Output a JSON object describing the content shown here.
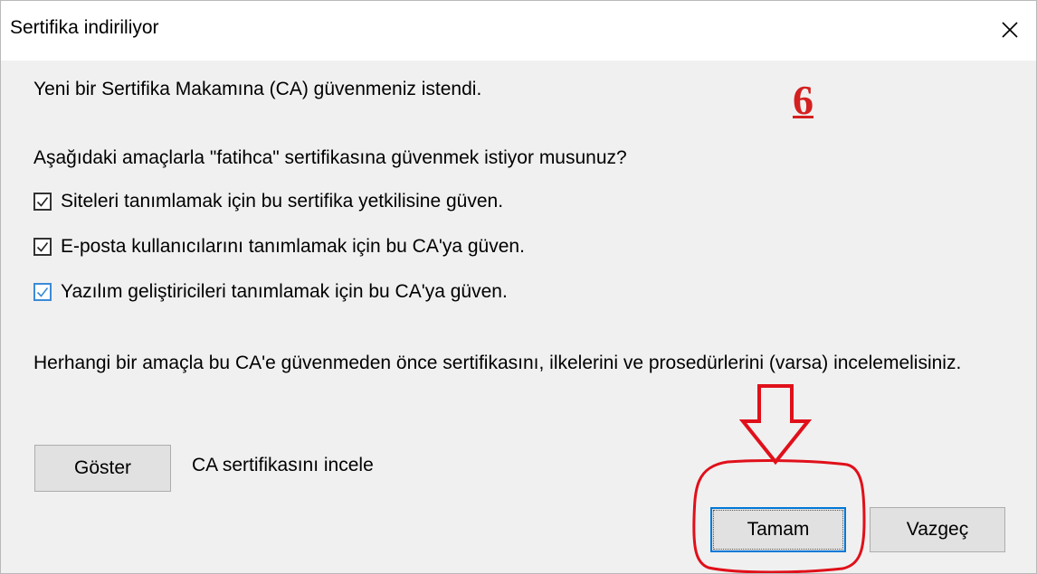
{
  "dialog": {
    "title": "Sertifika indiriliyor",
    "intro": "Yeni bir Sertifika Makamına (CA) güvenmeniz istendi.",
    "question": "Aşağıdaki amaçlarla \"fatihca\" sertifikasına güvenmek istiyor musunuz?",
    "options": [
      {
        "label": "Siteleri tanımlamak için bu sertifika yetkilisine güven.",
        "checked": true
      },
      {
        "label": "E-posta kullanıcılarını tanımlamak için bu CA'ya güven.",
        "checked": true
      },
      {
        "label": "Yazılım geliştiricileri tanımlamak için bu CA'ya güven.",
        "checked": true
      }
    ],
    "notice": "Herhangi bir amaçla bu CA'e güvenmeden önce sertifikasını, ilkelerini ve prosedürlerini (varsa) incelemelisiniz.",
    "show_button": "Göster",
    "show_description": "CA sertifikasını incele",
    "ok_button": "Tamam",
    "cancel_button": "Vazgeç"
  },
  "annotation": {
    "step_number": "6",
    "color": "#d42020"
  },
  "icons": {
    "close": "close-icon",
    "checkbox": "checkmark-icon",
    "arrow": "down-arrow-icon"
  }
}
